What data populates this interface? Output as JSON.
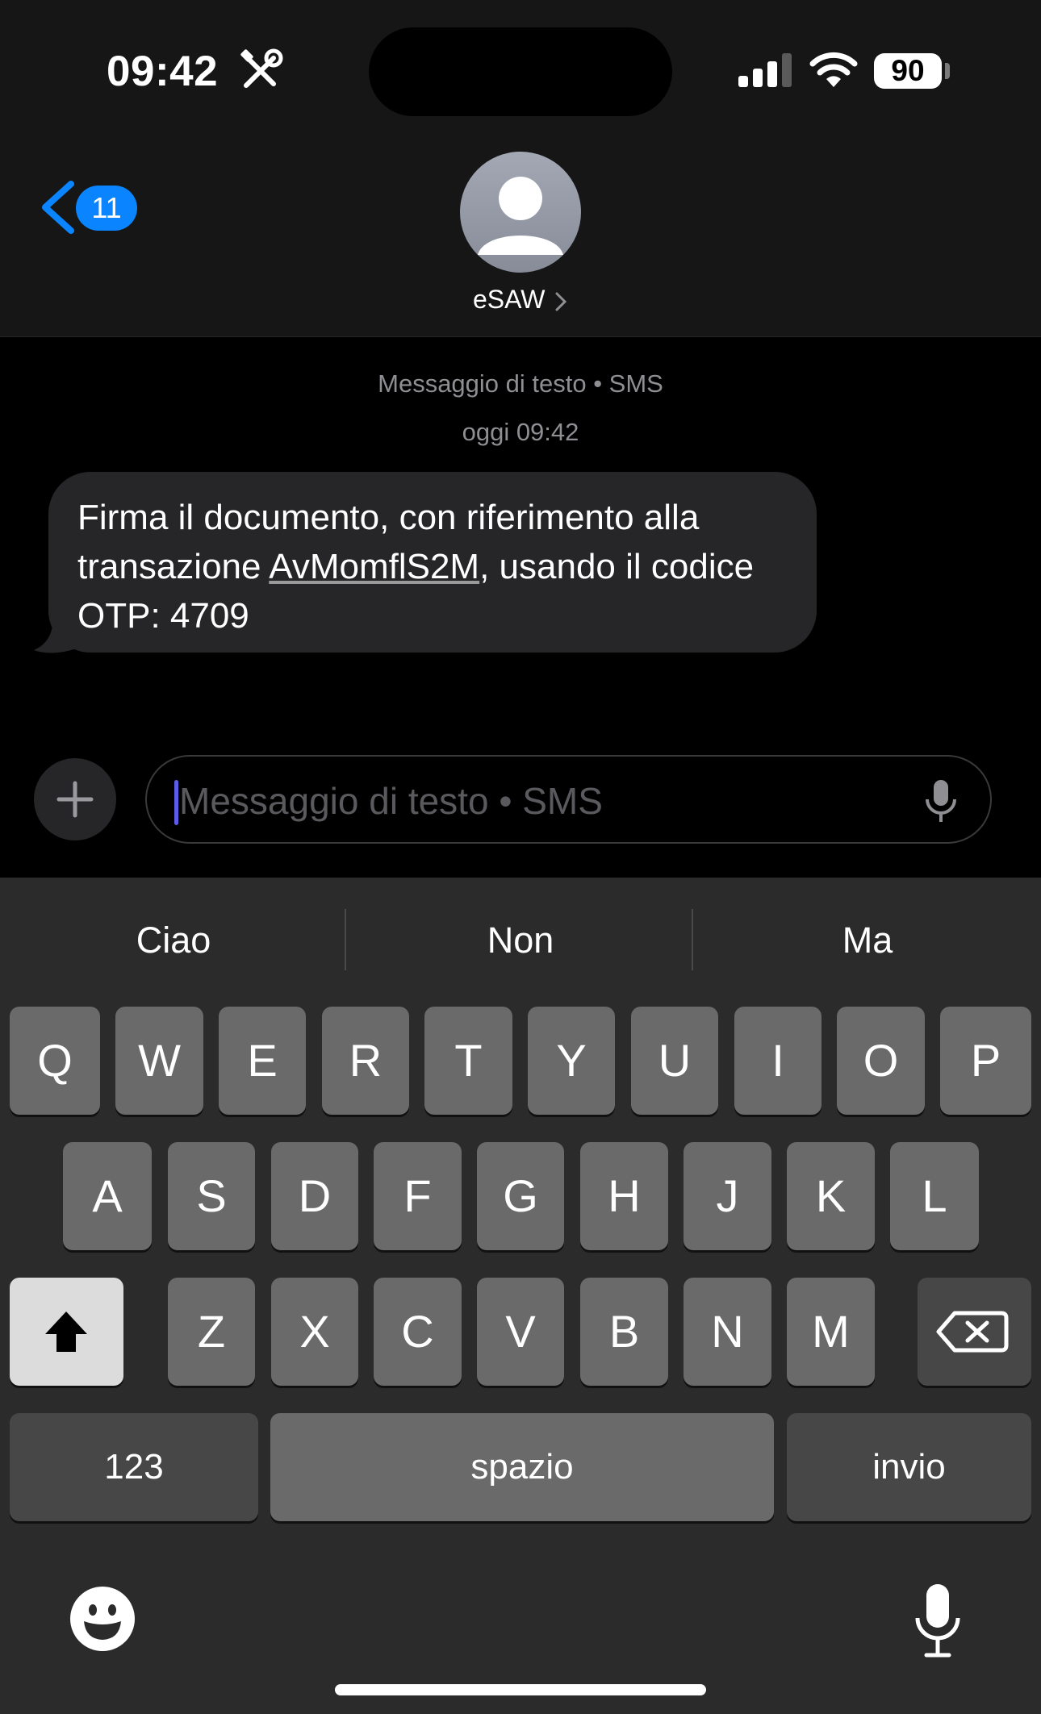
{
  "status_bar": {
    "time": "09:42",
    "battery": "90"
  },
  "nav": {
    "back_badge": "11",
    "contact_name": "eSAW"
  },
  "conversation": {
    "type_label": "Messaggio di testo • SMS",
    "timestamp": "oggi 09:42",
    "message": {
      "part1": "Firma il documento, con riferimento alla transazione ",
      "link": "AvMomflS2M",
      "part2": ", usando il codice OTP: 4709"
    }
  },
  "compose": {
    "placeholder": "Messaggio di testo • SMS"
  },
  "keyboard": {
    "suggestions": [
      "Ciao",
      "Non",
      "Ma"
    ],
    "row1": [
      "Q",
      "W",
      "E",
      "R",
      "T",
      "Y",
      "U",
      "I",
      "O",
      "P"
    ],
    "row2": [
      "A",
      "S",
      "D",
      "F",
      "G",
      "H",
      "J",
      "K",
      "L"
    ],
    "row3": [
      "Z",
      "X",
      "C",
      "V",
      "B",
      "N",
      "M"
    ],
    "numbers_label": "123",
    "space_label": "spazio",
    "return_label": "invio"
  },
  "colors": {
    "accent": "#0a84ff",
    "bubble": "#262628",
    "keyboard": "#2b2b2b",
    "key": "#6a6a6a"
  }
}
